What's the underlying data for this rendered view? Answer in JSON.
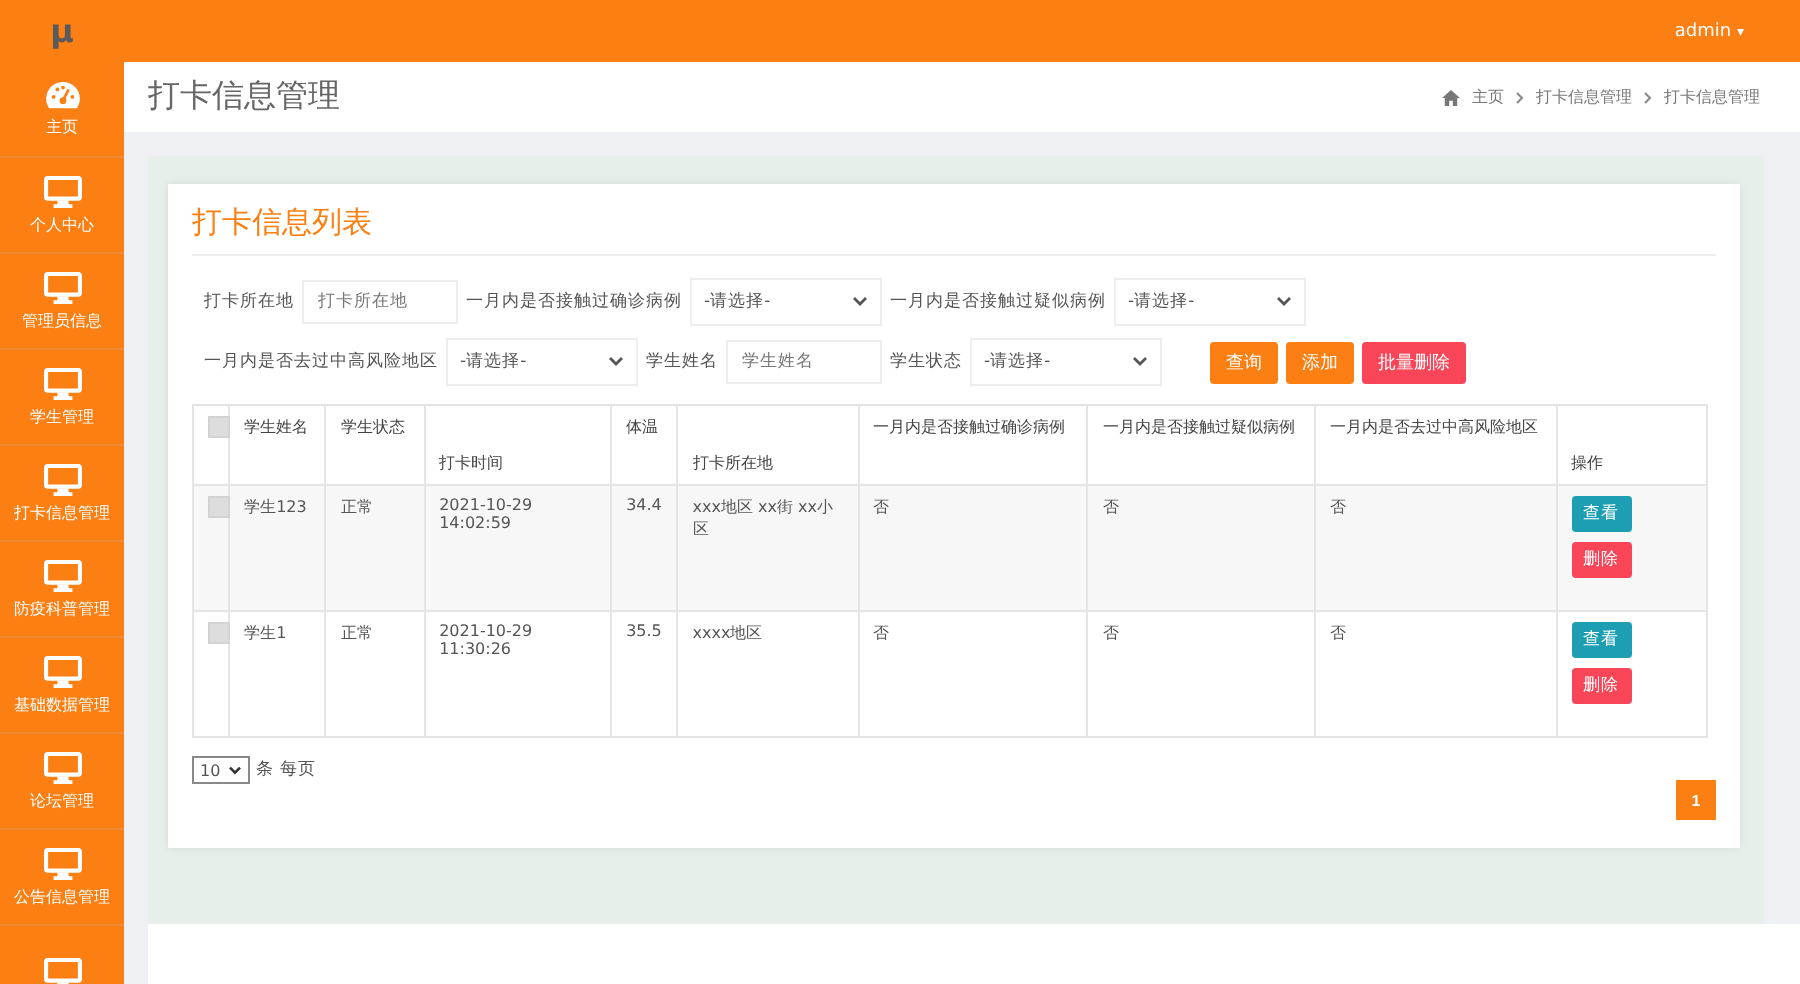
{
  "topbar": {
    "logo": "μ",
    "user": "admin",
    "caret": "▾"
  },
  "sidebar": {
    "items": [
      {
        "kind": "entry",
        "label": "主页"
      },
      {
        "kind": "entry",
        "label": "个人中心"
      },
      {
        "kind": "entry",
        "label": "管理员信息"
      },
      {
        "kind": "entry",
        "label": "学生管理"
      },
      {
        "kind": "entry",
        "label": "打卡信息管理"
      },
      {
        "kind": "entry",
        "label": "防疫科普管理"
      },
      {
        "kind": "entry",
        "label": "基础数据管理"
      },
      {
        "kind": "entry",
        "label": "论坛管理"
      },
      {
        "kind": "entry",
        "label": "公告信息管理"
      },
      {
        "kind": "cut_off"
      }
    ]
  },
  "page_title": "打卡信息管理",
  "breadcrumb": [
    "主页",
    "打卡信息管理",
    "打卡信息管理"
  ],
  "card_title": "打卡信息列表",
  "filters": [
    [
      {
        "kind": "input",
        "label": "打卡所在地",
        "placeholder": "打卡所在地"
      },
      {
        "kind": "select",
        "label": "一月内是否接触过确诊病例",
        "value": "-请选择-"
      },
      {
        "kind": "select",
        "label": "一月内是否接触过疑似病例",
        "value": "-请选择-"
      }
    ],
    [
      {
        "kind": "select",
        "label": "一月内是否去过中高风险地区",
        "value": "-请选择-"
      },
      {
        "kind": "input",
        "label": "学生姓名",
        "placeholder": "学生姓名"
      },
      {
        "kind": "select",
        "label": "学生状态",
        "value": "-请选择-"
      }
    ]
  ],
  "actions": [
    {
      "label": "查询",
      "kind": "primary"
    },
    {
      "label": "添加",
      "kind": "primary"
    },
    {
      "label": "批量删除",
      "kind": "danger"
    }
  ],
  "table": {
    "all_checked": false,
    "columns": [
      "学生姓名",
      "学生状态",
      "打卡时间",
      "体温",
      "打卡所在地",
      "一月内是否接触过确诊病例",
      "一月内是否接触过疑似病例",
      "一月内是否去过中高风险地区",
      "操作"
    ],
    "rows": [
      {
        "checked": false,
        "cells": [
          "学生123",
          "正常",
          "2021-10-29 14:02:59",
          "34.4",
          "xxx地区 xx街 xx小区",
          "否",
          "否",
          "否"
        ],
        "buttons": [
          "查看",
          "删除"
        ]
      },
      {
        "checked": false,
        "cells": [
          "学生1",
          "正常",
          "2021-10-29 11:30:26",
          "35.5",
          "xxxx地区",
          "否",
          "否",
          "否"
        ],
        "buttons": [
          "查看",
          "删除"
        ]
      }
    ]
  },
  "page_size": {
    "value": "10",
    "suffix": "条 每页"
  },
  "pagination": [
    {
      "label": "1",
      "selected": true
    }
  ]
}
